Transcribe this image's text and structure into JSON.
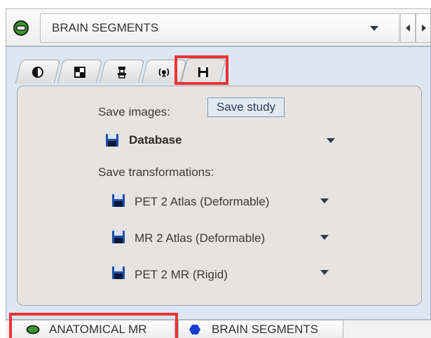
{
  "header": {
    "selector_value": "BRAIN SEGMENTS",
    "icon": "segment-green-icon",
    "dropdown_icon": "chevron-down-icon",
    "nav_prev_icon": "arrow-left-icon",
    "nav_next_icon": "arrow-right-icon"
  },
  "tabs": [
    {
      "icon": "contrast-icon"
    },
    {
      "icon": "layout-grid-icon"
    },
    {
      "icon": "scanner-icon"
    },
    {
      "icon": "radiation-icon"
    },
    {
      "icon": "save-floppy-icon",
      "active": true
    }
  ],
  "panel": {
    "save_images_label": "Save images:",
    "save_study_button": "Save study",
    "images_target": "Database",
    "save_transformations_label": "Save transformations:",
    "transformations": [
      {
        "label": "PET 2 Atlas (Deformable)"
      },
      {
        "label": "MR 2 Atlas (Deformable)"
      },
      {
        "label": "PET 2 MR (Rigid)"
      }
    ]
  },
  "bottom_tabs": [
    {
      "label": "ANATOMICAL MR",
      "icon": "green-oval-icon",
      "active": true
    },
    {
      "label": "BRAIN SEGMENTS",
      "icon": "blue-hexagon-icon",
      "active": false
    }
  ],
  "colors": {
    "highlight": "#ee3333",
    "panel_blue": "#dce7f3",
    "panel_gray": "#e6e3e1",
    "green_icon": "#3c9a2c",
    "blue_icon": "#1a3fd0",
    "floppy_blue": "#1f4fa8"
  }
}
